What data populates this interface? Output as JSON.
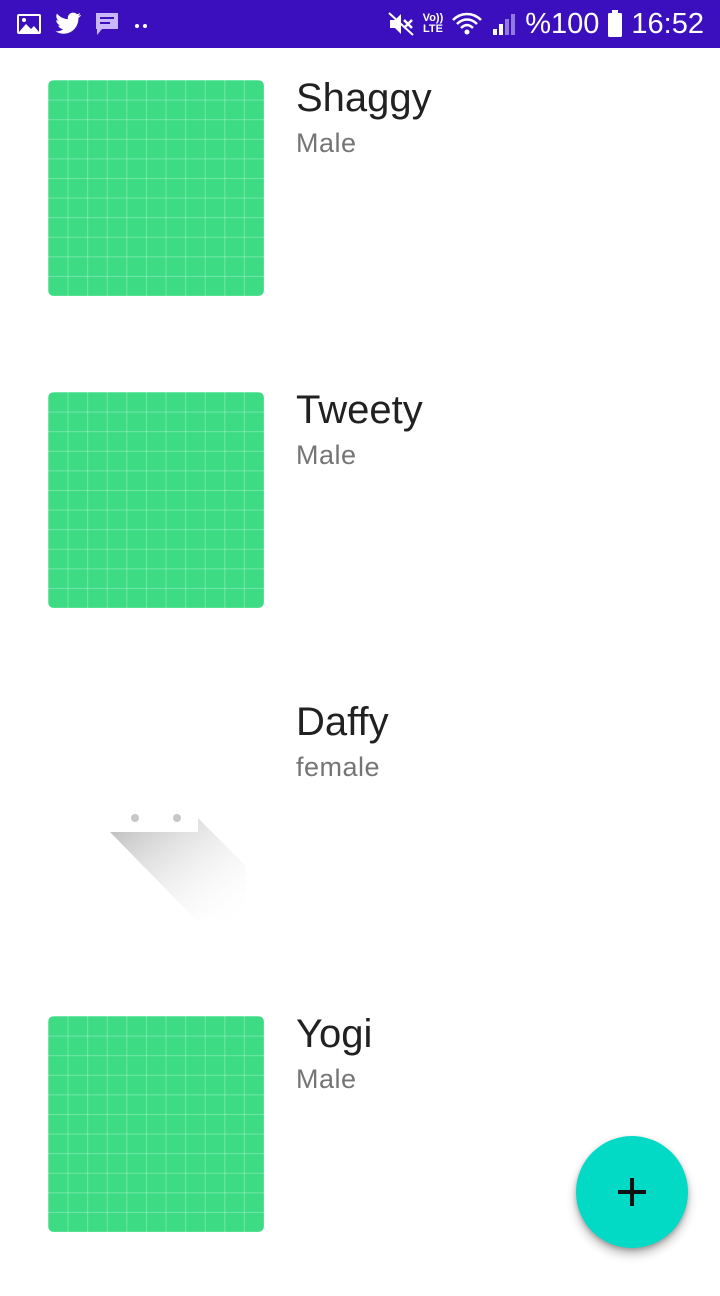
{
  "status_bar": {
    "background": "#3b0fbd",
    "left_icons": [
      "gallery-icon",
      "twitter-icon",
      "message-icon",
      "more-dots-icon"
    ],
    "right_icons": [
      "mute-icon",
      "volte-icon",
      "wifi-icon",
      "signal-icon",
      "battery-icon"
    ],
    "volte_top": "Vo))",
    "volte_bottom": "LTE",
    "battery_percent": "%100",
    "time": "16:52"
  },
  "items": [
    {
      "name": "Shaggy",
      "gender": "Male",
      "image": "green-grid"
    },
    {
      "name": "Tweety",
      "gender": "Male",
      "image": "green-grid"
    },
    {
      "name": "Daffy",
      "gender": "female",
      "image": "broken-image-placeholder"
    },
    {
      "name": "Yogi",
      "gender": "Male",
      "image": "green-grid"
    }
  ],
  "fab": {
    "icon": "plus-icon",
    "color": "#03dac6"
  },
  "colors": {
    "thumbnail": "#3ddc84",
    "name_text": "#212121",
    "secondary_text": "#757575"
  }
}
